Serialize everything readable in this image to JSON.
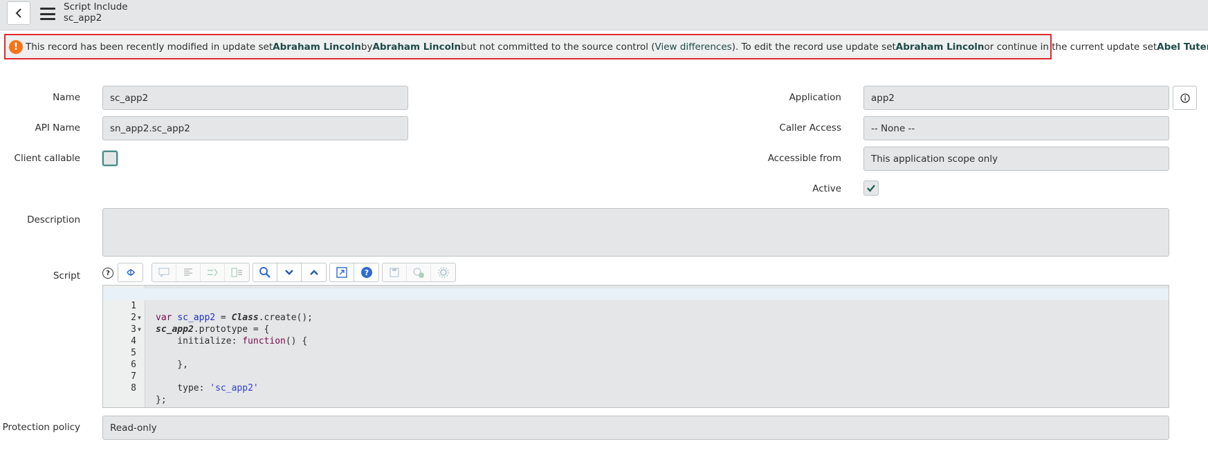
{
  "header": {
    "title": "Script Include",
    "subtitle": "sc_app2"
  },
  "alert": {
    "t1": "This record has been recently modified in update set ",
    "set1": "Abraham Lincoln",
    "t2": " by ",
    "user": "Abraham Lincoln",
    "t3": " but not committed to the source control (",
    "link": "View differences",
    "t4": "). To edit the record use update set ",
    "set2": "Abraham Lincoln",
    "t5": " or continue in the current update set ",
    "current": "Abel Tuter"
  },
  "form": {
    "name": {
      "label": "Name",
      "value": "sc_app2"
    },
    "api_name": {
      "label": "API Name",
      "value": "sn_app2.sc_app2"
    },
    "client_callable": {
      "label": "Client callable",
      "checked": false
    },
    "application": {
      "label": "Application",
      "value": "app2"
    },
    "caller_access": {
      "label": "Caller Access",
      "value": "-- None --"
    },
    "accessible_from": {
      "label": "Accessible from",
      "value": "This application scope only"
    },
    "active": {
      "label": "Active",
      "checked": true
    },
    "description": {
      "label": "Description",
      "value": ""
    },
    "script": {
      "label": "Script"
    },
    "protection_policy": {
      "label": "Protection policy",
      "value": "Read-only"
    }
  },
  "editor": {
    "line_numbers": [
      "1",
      "2",
      "3",
      "4",
      "5",
      "6",
      "7",
      "8"
    ],
    "lines": [
      "var sc_app2 = Class.create();",
      "sc_app2.prototype = {",
      "    initialize: function() {",
      "",
      "    },",
      "",
      "    type: 'sc_app2'",
      "};"
    ]
  },
  "colors": {
    "alert_border": "#e0282e",
    "alert_icon": "#f5761a",
    "link": "#1d4a47",
    "keyword": "#7a0b4f"
  }
}
